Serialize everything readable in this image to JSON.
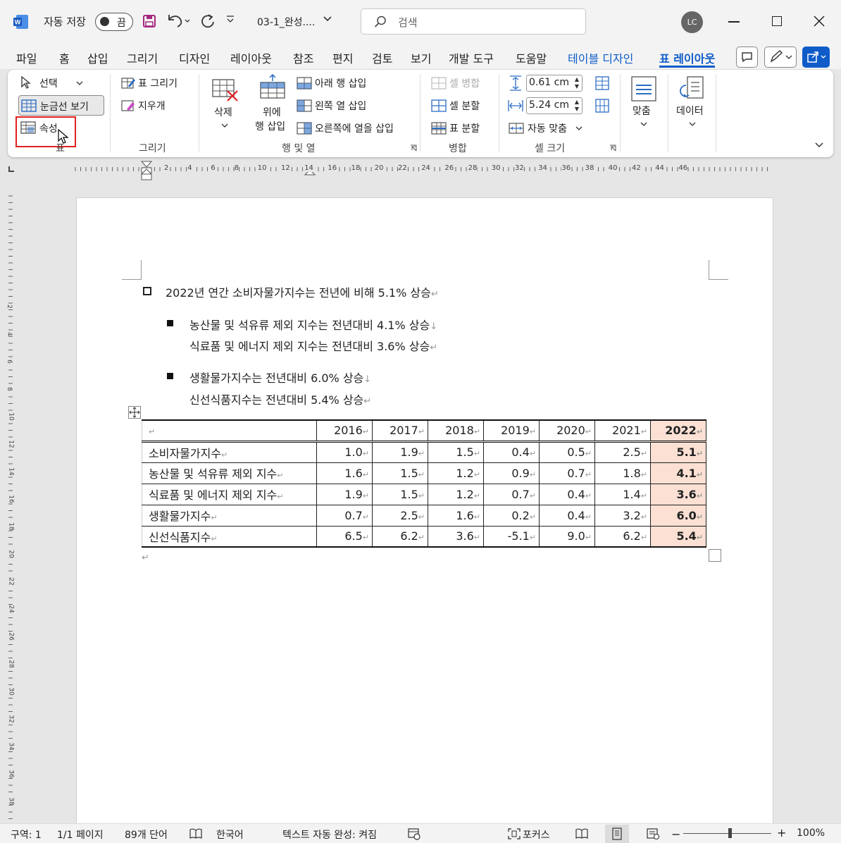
{
  "titlebar": {
    "autosave_label": "자동 저장",
    "autosave_state": "끔",
    "filename": "03-1_완성....",
    "search_placeholder": "검색",
    "avatar_initials": "LC"
  },
  "menu_tabs": [
    "파일",
    "홈",
    "삽입",
    "그리기",
    "디자인",
    "레이아웃",
    "참조",
    "편지",
    "검토",
    "보기",
    "개발 도구",
    "도움말",
    "테이블 디자인",
    "표 레이아웃"
  ],
  "ribbon": {
    "table_group": {
      "select": "선택",
      "gridlines": "눈금선 보기",
      "properties": "속성",
      "label": "표"
    },
    "draw_group": {
      "draw_table": "표 그리기",
      "eraser": "지우개",
      "label": "그리기"
    },
    "rows_cols_group": {
      "delete": "삭제",
      "insert_above_1": "위에",
      "insert_above_2": "행 삽입",
      "insert_below": "아래 행 삽입",
      "insert_left": "왼쪽 열 삽입",
      "insert_right": "오른쪽에 열을 삽입",
      "label": "행 및 열"
    },
    "merge_group": {
      "merge_cells": "셀 병합",
      "split_cells": "셀 분할",
      "split_table": "표 분할",
      "label": "병합"
    },
    "cell_size_group": {
      "height": "0.61 cm",
      "width": "5.24 cm",
      "autofit": "자동 맞춤",
      "label": "셀 크기"
    },
    "alignment": "맞춤",
    "data": "데이터"
  },
  "ruler_labels": [
    "2",
    "4",
    "6",
    "8",
    "10",
    "12",
    "14",
    "16",
    "18",
    "20",
    "22",
    "24",
    "26",
    "28",
    "30",
    "32",
    "34",
    "36",
    "38",
    "40",
    "42",
    "44",
    "46"
  ],
  "vruler_labels": [
    "2",
    "4",
    "6",
    "8",
    "10",
    "12",
    "14",
    "16",
    "18",
    "20",
    "22",
    "24",
    "26",
    "28",
    "30",
    "32",
    "34",
    "36",
    "38"
  ],
  "document": {
    "bullet1": "2022년 연간 소비자물가지수는 전년에 비해 5.1% 상승",
    "sub1_line1": "농산물 및 석유류 제외 지수는 전년대비 4.1% 상승",
    "sub1_line2": "식료품 및 에너지 제외 지수는 전년대비 3.6% 상승",
    "sub2_line1": "생활물가지수는 전년대비 6.0% 상승",
    "sub2_line2": "신선식품지수는 전년대비 5.4% 상승",
    "table": {
      "headers": [
        "",
        "2016",
        "2017",
        "2018",
        "2019",
        "2020",
        "2021",
        "2022"
      ],
      "rows": [
        [
          "소비자물가지수",
          "1.0",
          "1.9",
          "1.5",
          "0.4",
          "0.5",
          "2.5",
          "5.1"
        ],
        [
          "농산물 및 석유류 제외 지수",
          "1.6",
          "1.5",
          "1.2",
          "0.9",
          "0.7",
          "1.8",
          "4.1"
        ],
        [
          "식료품 및 에너지 제외 지수",
          "1.9",
          "1.5",
          "1.2",
          "0.7",
          "0.4",
          "1.4",
          "3.6"
        ],
        [
          "생활물가지수",
          "0.7",
          "2.5",
          "1.6",
          "0.2",
          "0.4",
          "3.2",
          "6.0"
        ],
        [
          "신선식품지수",
          "6.5",
          "6.2",
          "3.6",
          "-5.1",
          "9.0",
          "6.2",
          "5.4"
        ]
      ]
    }
  },
  "statusbar": {
    "section": "구역: 1",
    "page": "1/1 페이지",
    "words": "89개 단어",
    "language": "한국어",
    "autocomplete": "텍스트 자동 완성: 켜짐",
    "focus": "포커스",
    "zoom": "100%"
  },
  "colors": {
    "accent": "#0f5cc9",
    "highlight_column": "#fbe0d3",
    "callout": "#e02020",
    "word_brand": "#185abd",
    "save_icon": "#a4287f"
  }
}
